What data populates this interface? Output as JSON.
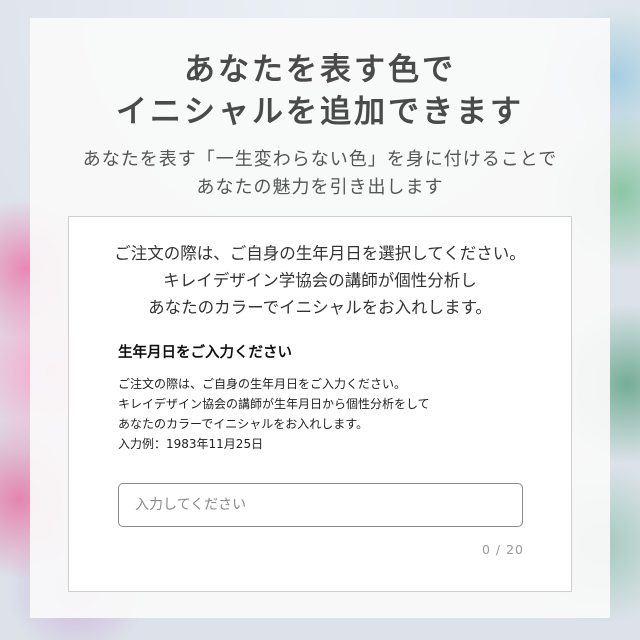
{
  "heading": {
    "line1": "あなたを表す色で",
    "line2": "イニシャルを追加できます"
  },
  "subheading": {
    "line1": "あなたを表す「一生変わらない色」を身に付けることで",
    "line2": "あなたの魅力を引き出します"
  },
  "intro": {
    "line1": "ご注文の際は、ご自身の生年月日を選択してください。",
    "line2": "キレイデザイン学協会の講師が個性分析し",
    "line3": "あなたのカラーでイニシャルをお入れします。"
  },
  "form": {
    "title": "生年月日をご入力ください",
    "desc1": "ご注文の際は、ご自身の生年月日をご入力ください。",
    "desc2": "キレイデザイン協会の講師が生年月日から個性分析をして",
    "desc3": "あなたのカラーでイニシャルをお入れします。",
    "desc4": "入力例：1983年11月25日",
    "placeholder": "入力してください",
    "value": "",
    "counter": "0 / 20"
  }
}
